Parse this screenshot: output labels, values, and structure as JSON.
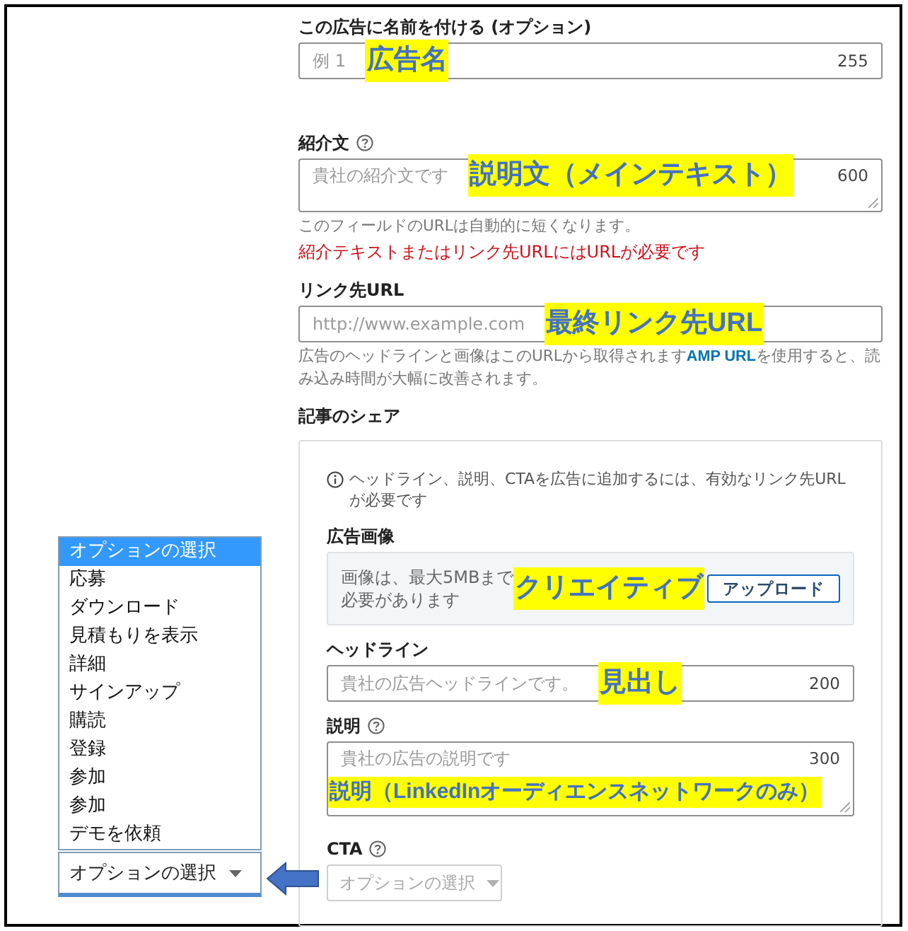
{
  "form": {
    "sections": [
      {
        "fields": [
          {
            "kind": "input",
            "label": "この広告に名前を付ける (オプション)",
            "help": false,
            "placeholder": "例 1",
            "counter": "255",
            "annotation": {
              "kind": "inline",
              "text": "広告名"
            }
          }
        ]
      },
      {
        "fields": [
          {
            "kind": "textarea",
            "label": "紹介文",
            "help": true,
            "placeholder": "貴社の紹介文です",
            "counter": "600",
            "annotation": {
              "kind": "inline",
              "text": "説明文（メインテキスト）"
            },
            "notes": [
              {
                "kind": "hint",
                "text": "このフィールドのURLは自動的に短くなります。"
              },
              {
                "kind": "error",
                "text": "紹介テキストまたはリンク先URLにはURLが必要です"
              }
            ]
          },
          {
            "kind": "input",
            "label": "リンク先URL",
            "help": false,
            "placeholder": "http://www.example.com",
            "annotation": {
              "kind": "inline",
              "text": "最終リンク先URL"
            },
            "notes": [
              {
                "kind": "hint",
                "text": "広告のヘッドラインと画像はこのURLから取得されます",
                "link": "AMP URL",
                "text_after": "を使用すると、読み込み時間が大幅に改善されます。"
              }
            ]
          }
        ]
      }
    ]
  },
  "article_share": {
    "title": "記事のシェア",
    "info": "ヘッドライン、説明、CTAを広告に追加するには、有効なリンク先URLが必要です",
    "image": {
      "label": "広告画像",
      "lines": [
        "画像は、最大5MBまで",
        "必要があります"
      ],
      "annotation": {
        "kind": "inline",
        "text": "クリエイティブ"
      },
      "button": "アップロード"
    },
    "fields": [
      {
        "kind": "input",
        "label": "ヘッドライン",
        "help": false,
        "placeholder": "貴社の広告ヘッドラインです。",
        "counter": "200",
        "annotation": {
          "kind": "inline",
          "text": "見出し"
        }
      },
      {
        "kind": "textarea",
        "label": "説明",
        "help": true,
        "placeholder": "貴社の広告の説明です",
        "counter": "300",
        "annotation": {
          "kind": "below",
          "text": "説明（LinkedInオーディエンスネットワークのみ）"
        }
      },
      {
        "kind": "select",
        "label": "CTA",
        "help": true,
        "value": "オプションの選択",
        "disabled": true
      }
    ]
  },
  "cta_dropdown": {
    "expanded": true,
    "options": [
      {
        "label": "オプションの選択",
        "selected": true
      },
      {
        "label": "応募",
        "selected": false
      },
      {
        "label": "ダウンロード",
        "selected": false
      },
      {
        "label": "見積もりを表示",
        "selected": false
      },
      {
        "label": "詳細",
        "selected": false
      },
      {
        "label": "サインアップ",
        "selected": false
      },
      {
        "label": "購読",
        "selected": false
      },
      {
        "label": "登録",
        "selected": false
      },
      {
        "label": "参加",
        "selected": false
      },
      {
        "label": "参加",
        "selected": false
      },
      {
        "label": "デモを依頼",
        "selected": false
      }
    ],
    "value": "オプションの選択"
  }
}
